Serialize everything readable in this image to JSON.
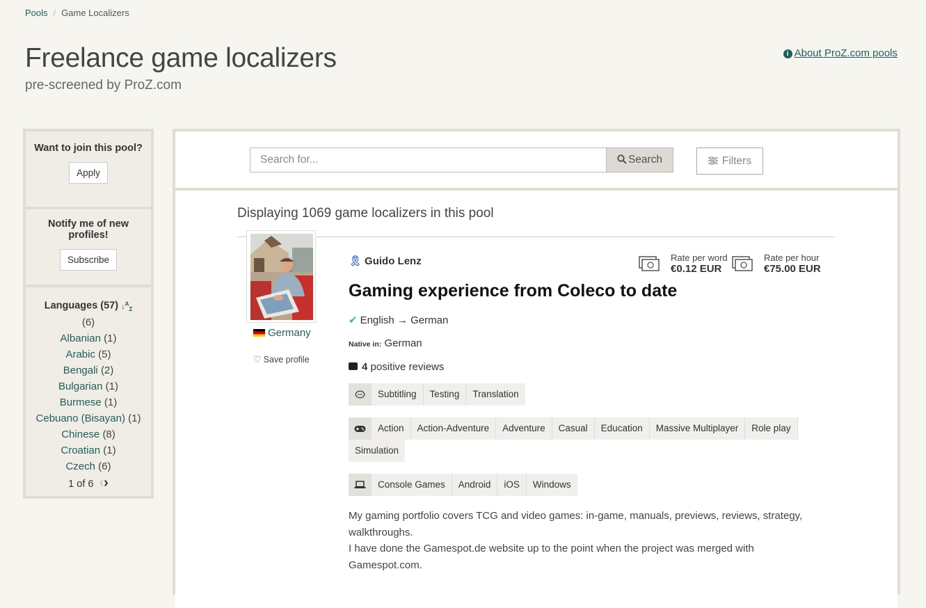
{
  "breadcrumb": {
    "root": "Pools",
    "current": "Game Localizers"
  },
  "header": {
    "title": "Freelance game localizers",
    "subtitle": "pre-screened by ProZ.com",
    "about_link": "About ProZ.com pools"
  },
  "sidebar": {
    "join": {
      "heading": "Want to join this pool?",
      "button": "Apply"
    },
    "notify": {
      "heading": "Notify me of new profiles!",
      "button": "Subscribe"
    },
    "languages": {
      "heading": "Languages (57)",
      "items": [
        {
          "name": "",
          "count": "(6)"
        },
        {
          "name": "Albanian",
          "count": "(1)"
        },
        {
          "name": "Arabic",
          "count": "(5)"
        },
        {
          "name": "Bengali",
          "count": "(2)"
        },
        {
          "name": "Bulgarian",
          "count": "(1)"
        },
        {
          "name": "Burmese",
          "count": "(1)"
        },
        {
          "name": "Cebuano (Bisayan)",
          "count": "(1)"
        },
        {
          "name": "Chinese",
          "count": "(8)"
        },
        {
          "name": "Croatian",
          "count": "(1)"
        },
        {
          "name": "Czech",
          "count": "(6)"
        }
      ],
      "pager": "1 of 6"
    }
  },
  "search": {
    "placeholder": "Search for...",
    "button": "Search",
    "filters": "Filters"
  },
  "results": {
    "count_text": "Displaying 1069 game localizers in this pool",
    "profile": {
      "name": "Guido Lenz",
      "country": "Germany",
      "save": "Save profile",
      "rate_word_label": "Rate per word",
      "rate_word_value": "€0.12 EUR",
      "rate_hour_label": "Rate per hour",
      "rate_hour_value": "€75.00 EUR",
      "headline": "Gaming experience from Coleco to date",
      "source_lang": "English",
      "target_lang": "German",
      "native_label": "Native in:",
      "native_lang": "German",
      "reviews_count": "4",
      "reviews_text": "positive reviews",
      "services": [
        "Subtitling",
        "Testing",
        "Translation"
      ],
      "genres": [
        "Action",
        "Action-Adventure",
        "Adventure",
        "Casual",
        "Education",
        "Massive Multiplayer",
        "Role play",
        "Simulation"
      ],
      "platforms": [
        "Console Games",
        "Android",
        "iOS",
        "Windows"
      ],
      "bio_1": "My gaming portfolio covers TCG and video games: in-game, manuals, previews, reviews, strategy, walkthroughs.",
      "bio_2": "I have done the Gamespot.de website up to the point when the project was merged with Gamespot.com."
    }
  },
  "colors": {
    "link": "#1f5f5b",
    "background": "#f6f5f0",
    "accent_check": "#3ab8a8"
  }
}
